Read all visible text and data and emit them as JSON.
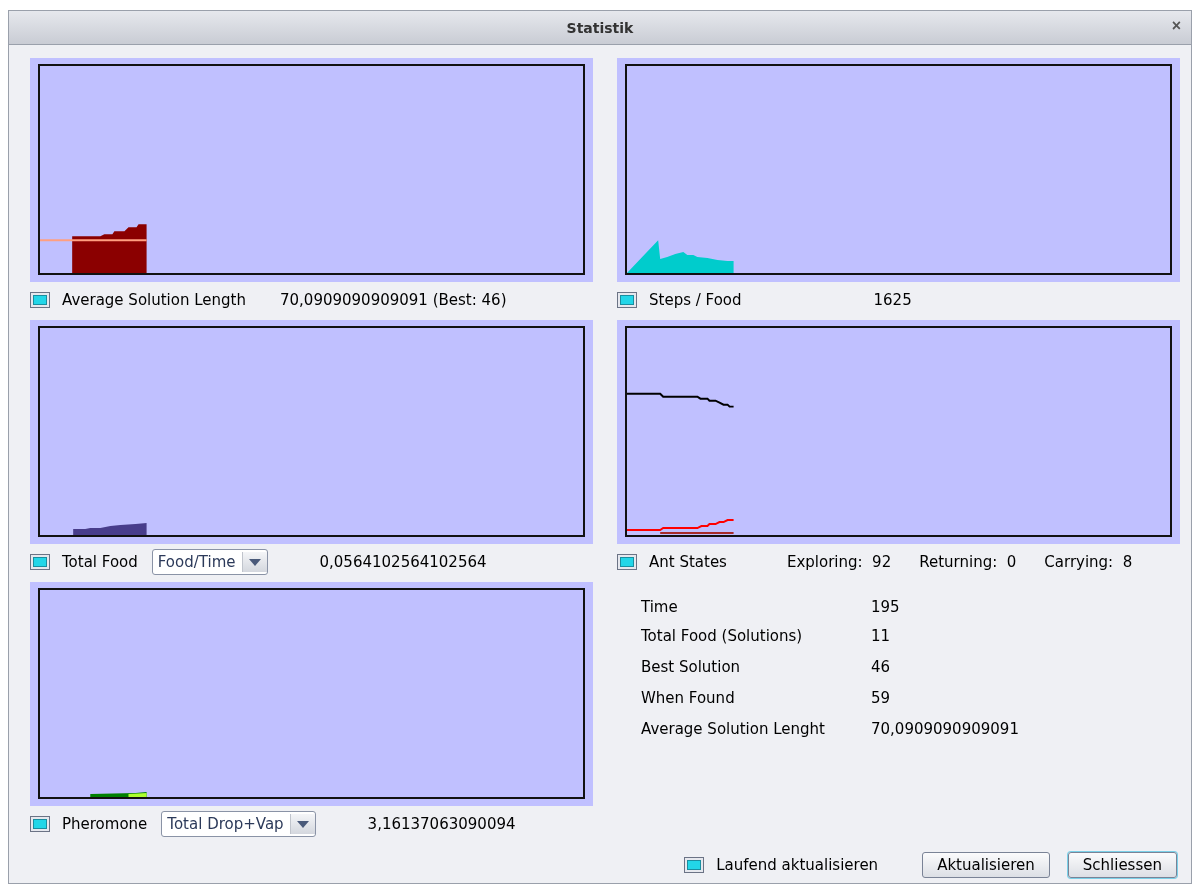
{
  "window": {
    "title": "Statistik",
    "close": "×"
  },
  "graphs": [
    {
      "kind": "plain",
      "checked": true,
      "label": "Average Solution Length",
      "reading": "70,0909090909091 (Best: 46)"
    },
    {
      "kind": "plain",
      "checked": true,
      "label": "Steps / Food",
      "reading": "1625"
    },
    {
      "kind": "dropdown",
      "checked": true,
      "label": "Total Food",
      "dropdown": "Food/Time",
      "reading": "0,0564102564102564"
    },
    {
      "kind": "states",
      "checked": true,
      "label": "Ant States",
      "counts": [
        {
          "label": "Exploring:",
          "value": "92"
        },
        {
          "label": "Returning:",
          "value": "0"
        },
        {
          "label": "Carrying:",
          "value": "8"
        }
      ]
    },
    {
      "kind": "dropdown",
      "checked": true,
      "label": "Pheromone",
      "dropdown": "Total Drop+Vap",
      "reading": "3,16137063090094"
    }
  ],
  "summary": [
    {
      "label": "Time",
      "value": "195"
    },
    {
      "label": "Total Food (Solutions)",
      "value": "11"
    },
    {
      "label": "Best Solution",
      "value": "46"
    },
    {
      "label": "When Found",
      "value": "59"
    },
    {
      "label": "Average Solution Lenght",
      "value": "70,0909090909091"
    }
  ],
  "footer": {
    "auto_update": {
      "label": "Laufend aktualisieren",
      "checked": true
    },
    "buttons": [
      "Aktualisieren",
      "Schliessen"
    ]
  }
}
